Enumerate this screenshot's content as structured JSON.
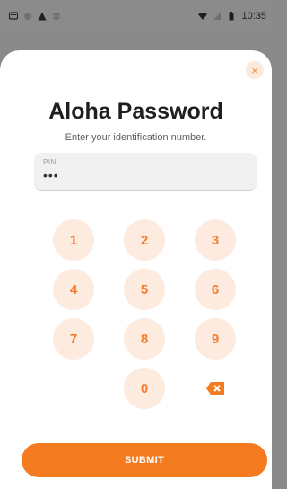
{
  "status_bar": {
    "time": "10:35",
    "left_icons": [
      "message-icon",
      "circle-dot-icon",
      "warning-icon",
      "globe-icon"
    ],
    "right_icons": [
      "wifi-icon",
      "signal-icon",
      "battery-icon"
    ]
  },
  "dialog": {
    "title": "Aloha Password",
    "subtitle": "Enter your identification number.",
    "close_label": "×",
    "pin": {
      "label": "PIN",
      "value": "•••"
    },
    "keypad": {
      "keys": [
        "1",
        "2",
        "3",
        "4",
        "5",
        "6",
        "7",
        "8",
        "9",
        "0"
      ],
      "backspace_icon": "backspace-icon"
    },
    "submit_label": "SUBMIT"
  },
  "colors": {
    "accent": "#f47b20",
    "key_bg": "#fdebe0",
    "status_bar_bg": "#8b8b8b"
  }
}
